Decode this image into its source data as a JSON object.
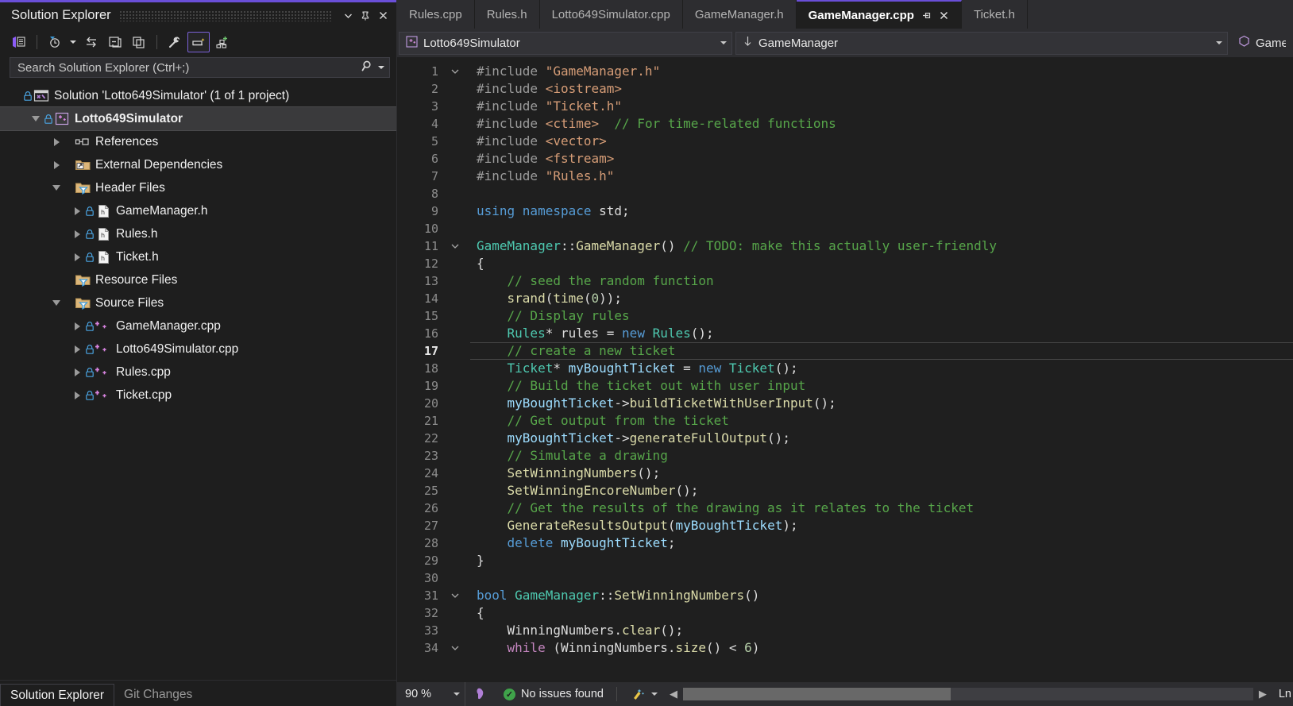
{
  "solution_explorer": {
    "title": "Solution Explorer",
    "header_buttons": [
      {
        "name": "dropdown-chevron",
        "glyph": "▾"
      },
      {
        "name": "pin",
        "glyph": "pin"
      },
      {
        "name": "close",
        "glyph": "✕"
      }
    ],
    "toolbar": [
      {
        "name": "home-view-icon",
        "label": "Home"
      },
      {
        "name": "pending-changes-icon",
        "label": "Pending Changes Filter"
      },
      {
        "name": "sync-with-active-document-icon",
        "label": "Sync with Active Document"
      },
      {
        "name": "collapse-all-icon",
        "label": "Collapse All"
      },
      {
        "name": "show-all-files-icon",
        "label": "Show All Files"
      },
      {
        "name": "properties-icon",
        "label": "Properties"
      },
      {
        "name": "preview-selected-items-icon",
        "label": "Preview Selected Items"
      },
      {
        "name": "view-class-diagram-icon",
        "label": "View Class Diagram"
      }
    ],
    "search_placeholder": "Search Solution Explorer (Ctrl+;)",
    "tree": [
      {
        "label": "Solution 'Lotto649Simulator' (1 of 1 project)",
        "indent": 0,
        "expander": "none",
        "icon": "solution",
        "lock": true,
        "selected": false,
        "bold": false
      },
      {
        "label": "Lotto649Simulator",
        "indent": 1,
        "expander": "open",
        "icon": "cpp-project",
        "lock": true,
        "selected": true,
        "bold": true
      },
      {
        "label": "References",
        "indent": 2,
        "expander": "closed",
        "icon": "references",
        "lock": false,
        "selected": false,
        "bold": false
      },
      {
        "label": "External Dependencies",
        "indent": 2,
        "expander": "closed",
        "icon": "ext-deps",
        "lock": false,
        "selected": false,
        "bold": false
      },
      {
        "label": "Header Files",
        "indent": 2,
        "expander": "open",
        "icon": "filter-folder",
        "lock": false,
        "selected": false,
        "bold": false
      },
      {
        "label": "GameManager.h",
        "indent": 3,
        "expander": "closed",
        "icon": "h-file",
        "lock": true,
        "selected": false,
        "bold": false
      },
      {
        "label": "Rules.h",
        "indent": 3,
        "expander": "closed",
        "icon": "h-file",
        "lock": true,
        "selected": false,
        "bold": false
      },
      {
        "label": "Ticket.h",
        "indent": 3,
        "expander": "closed",
        "icon": "h-file",
        "lock": true,
        "selected": false,
        "bold": false
      },
      {
        "label": "Resource Files",
        "indent": 2,
        "expander": "none",
        "icon": "filter-folder",
        "lock": false,
        "selected": false,
        "bold": false
      },
      {
        "label": "Source Files",
        "indent": 2,
        "expander": "open",
        "icon": "filter-folder",
        "lock": false,
        "selected": false,
        "bold": false
      },
      {
        "label": "GameManager.cpp",
        "indent": 3,
        "expander": "closed",
        "icon": "cpp-file",
        "lock": true,
        "selected": false,
        "bold": false
      },
      {
        "label": "Lotto649Simulator.cpp",
        "indent": 3,
        "expander": "closed",
        "icon": "cpp-file",
        "lock": true,
        "selected": false,
        "bold": false
      },
      {
        "label": "Rules.cpp",
        "indent": 3,
        "expander": "closed",
        "icon": "cpp-file",
        "lock": true,
        "selected": false,
        "bold": false
      },
      {
        "label": "Ticket.cpp",
        "indent": 3,
        "expander": "closed",
        "icon": "cpp-file",
        "lock": true,
        "selected": false,
        "bold": false
      }
    ],
    "bottom_tabs": [
      {
        "label": "Solution Explorer",
        "active": true
      },
      {
        "label": "Git Changes",
        "active": false
      }
    ]
  },
  "editor": {
    "tabs": [
      {
        "label": "Rules.cpp",
        "active": false
      },
      {
        "label": "Rules.h",
        "active": false
      },
      {
        "label": "Lotto649Simulator.cpp",
        "active": false
      },
      {
        "label": "GameManager.h",
        "active": false
      },
      {
        "label": "GameManager.cpp",
        "active": true
      },
      {
        "label": "Ticket.h",
        "active": false
      }
    ],
    "navbar": {
      "project": "Lotto649Simulator",
      "class": "GameManager",
      "member": "GameManager()"
    },
    "current_line": 17,
    "lines": [
      {
        "n": 1,
        "fold": "open",
        "indent": 0,
        "tokens": [
          {
            "t": "#include ",
            "c": "c-pre"
          },
          {
            "t": "\"GameManager.h\"",
            "c": "c-str"
          }
        ]
      },
      {
        "n": 2,
        "fold": "",
        "indent": 1,
        "tokens": [
          {
            "t": "#include ",
            "c": "c-pre"
          },
          {
            "t": "<iostream>",
            "c": "c-str"
          }
        ]
      },
      {
        "n": 3,
        "fold": "",
        "indent": 1,
        "tokens": [
          {
            "t": "#include ",
            "c": "c-pre"
          },
          {
            "t": "\"Ticket.h\"",
            "c": "c-str"
          }
        ]
      },
      {
        "n": 4,
        "fold": "",
        "indent": 1,
        "tokens": [
          {
            "t": "#include ",
            "c": "c-pre"
          },
          {
            "t": "<ctime>",
            "c": "c-str"
          },
          {
            "t": "  ",
            "c": "c-pln"
          },
          {
            "t": "// For time-related functions",
            "c": "c-cmt"
          }
        ]
      },
      {
        "n": 5,
        "fold": "",
        "indent": 1,
        "tokens": [
          {
            "t": "#include ",
            "c": "c-pre"
          },
          {
            "t": "<vector>",
            "c": "c-str"
          }
        ]
      },
      {
        "n": 6,
        "fold": "",
        "indent": 1,
        "tokens": [
          {
            "t": "#include ",
            "c": "c-pre"
          },
          {
            "t": "<fstream>",
            "c": "c-str"
          }
        ]
      },
      {
        "n": 7,
        "fold": "",
        "indent": 1,
        "tokens": [
          {
            "t": "#include ",
            "c": "c-pre"
          },
          {
            "t": "\"Rules.h\"",
            "c": "c-str"
          }
        ]
      },
      {
        "n": 8,
        "fold": "",
        "indent": 0,
        "tokens": []
      },
      {
        "n": 9,
        "fold": "",
        "indent": 0,
        "tokens": [
          {
            "t": "using namespace ",
            "c": "c-kw"
          },
          {
            "t": "std",
            "c": "c-pln"
          },
          {
            "t": ";",
            "c": "c-pln"
          }
        ]
      },
      {
        "n": 10,
        "fold": "",
        "indent": 0,
        "tokens": []
      },
      {
        "n": 11,
        "fold": "open",
        "indent": 0,
        "tokens": [
          {
            "t": "GameManager",
            "c": "c-type"
          },
          {
            "t": "::",
            "c": "c-pln"
          },
          {
            "t": "GameManager",
            "c": "c-fn"
          },
          {
            "t": "() ",
            "c": "c-pln"
          },
          {
            "t": "// TODO: make this actually user-friendly",
            "c": "c-cmt"
          }
        ]
      },
      {
        "n": 12,
        "fold": "",
        "indent": 1,
        "tokens": [
          {
            "t": "{",
            "c": "c-pln"
          }
        ]
      },
      {
        "n": 13,
        "fold": "",
        "indent": 2,
        "tokens": [
          {
            "t": "    // seed the random function",
            "c": "c-cmt"
          }
        ]
      },
      {
        "n": 14,
        "fold": "",
        "indent": 2,
        "tokens": [
          {
            "t": "    ",
            "c": "c-pln"
          },
          {
            "t": "srand",
            "c": "c-fn"
          },
          {
            "t": "(",
            "c": "c-pln"
          },
          {
            "t": "time",
            "c": "c-fn"
          },
          {
            "t": "(",
            "c": "c-pln"
          },
          {
            "t": "0",
            "c": "c-num"
          },
          {
            "t": "));",
            "c": "c-pln"
          }
        ]
      },
      {
        "n": 15,
        "fold": "",
        "indent": 2,
        "tokens": [
          {
            "t": "    // Display rules",
            "c": "c-cmt"
          }
        ]
      },
      {
        "n": 16,
        "fold": "",
        "indent": 2,
        "tokens": [
          {
            "t": "    ",
            "c": "c-pln"
          },
          {
            "t": "Rules",
            "c": "c-type"
          },
          {
            "t": "* ",
            "c": "c-pln"
          },
          {
            "t": "rules",
            "c": "c-pln"
          },
          {
            "t": " = ",
            "c": "c-pln"
          },
          {
            "t": "new ",
            "c": "c-kw"
          },
          {
            "t": "Rules",
            "c": "c-type"
          },
          {
            "t": "();",
            "c": "c-pln"
          }
        ]
      },
      {
        "n": 17,
        "fold": "",
        "indent": 2,
        "tokens": [
          {
            "t": "    // create a new ticket",
            "c": "c-cmt"
          }
        ]
      },
      {
        "n": 18,
        "fold": "",
        "indent": 2,
        "tokens": [
          {
            "t": "    ",
            "c": "c-pln"
          },
          {
            "t": "Ticket",
            "c": "c-type"
          },
          {
            "t": "* ",
            "c": "c-pln"
          },
          {
            "t": "myBoughtTicket",
            "c": "c-var"
          },
          {
            "t": " = ",
            "c": "c-pln"
          },
          {
            "t": "new ",
            "c": "c-kw"
          },
          {
            "t": "Ticket",
            "c": "c-type"
          },
          {
            "t": "();",
            "c": "c-pln"
          }
        ]
      },
      {
        "n": 19,
        "fold": "",
        "indent": 2,
        "tokens": [
          {
            "t": "    // Build the ticket out with user input",
            "c": "c-cmt"
          }
        ]
      },
      {
        "n": 20,
        "fold": "",
        "indent": 2,
        "tokens": [
          {
            "t": "    ",
            "c": "c-pln"
          },
          {
            "t": "myBoughtTicket",
            "c": "c-var"
          },
          {
            "t": "->",
            "c": "c-pln"
          },
          {
            "t": "buildTicketWithUserInput",
            "c": "c-fn"
          },
          {
            "t": "();",
            "c": "c-pln"
          }
        ]
      },
      {
        "n": 21,
        "fold": "",
        "indent": 2,
        "tokens": [
          {
            "t": "    // Get output from the ticket",
            "c": "c-cmt"
          }
        ]
      },
      {
        "n": 22,
        "fold": "",
        "indent": 2,
        "tokens": [
          {
            "t": "    ",
            "c": "c-pln"
          },
          {
            "t": "myBoughtTicket",
            "c": "c-var"
          },
          {
            "t": "->",
            "c": "c-pln"
          },
          {
            "t": "generateFullOutput",
            "c": "c-fn"
          },
          {
            "t": "();",
            "c": "c-pln"
          }
        ]
      },
      {
        "n": 23,
        "fold": "",
        "indent": 2,
        "tokens": [
          {
            "t": "    // Simulate a drawing",
            "c": "c-cmt"
          }
        ]
      },
      {
        "n": 24,
        "fold": "",
        "indent": 2,
        "tokens": [
          {
            "t": "    ",
            "c": "c-pln"
          },
          {
            "t": "SetWinningNumbers",
            "c": "c-fn"
          },
          {
            "t": "();",
            "c": "c-pln"
          }
        ]
      },
      {
        "n": 25,
        "fold": "",
        "indent": 2,
        "tokens": [
          {
            "t": "    ",
            "c": "c-pln"
          },
          {
            "t": "SetWinningEncoreNumber",
            "c": "c-fn"
          },
          {
            "t": "();",
            "c": "c-pln"
          }
        ]
      },
      {
        "n": 26,
        "fold": "",
        "indent": 2,
        "tokens": [
          {
            "t": "    // Get the results of the drawing as it relates to the ticket",
            "c": "c-cmt"
          }
        ]
      },
      {
        "n": 27,
        "fold": "",
        "indent": 2,
        "tokens": [
          {
            "t": "    ",
            "c": "c-pln"
          },
          {
            "t": "GenerateResultsOutput",
            "c": "c-fn"
          },
          {
            "t": "(",
            "c": "c-pln"
          },
          {
            "t": "myBoughtTicket",
            "c": "c-var"
          },
          {
            "t": ");",
            "c": "c-pln"
          }
        ]
      },
      {
        "n": 28,
        "fold": "",
        "indent": 2,
        "tokens": [
          {
            "t": "    ",
            "c": "c-pln"
          },
          {
            "t": "delete ",
            "c": "c-kw"
          },
          {
            "t": "myBoughtTicket",
            "c": "c-var"
          },
          {
            "t": ";",
            "c": "c-pln"
          }
        ]
      },
      {
        "n": 29,
        "fold": "",
        "indent": 1,
        "tokens": [
          {
            "t": "}",
            "c": "c-pln"
          }
        ]
      },
      {
        "n": 30,
        "fold": "",
        "indent": 0,
        "tokens": []
      },
      {
        "n": 31,
        "fold": "open",
        "indent": 0,
        "tokens": [
          {
            "t": "bool ",
            "c": "c-kw"
          },
          {
            "t": "GameManager",
            "c": "c-type"
          },
          {
            "t": "::",
            "c": "c-pln"
          },
          {
            "t": "SetWinningNumbers",
            "c": "c-fn"
          },
          {
            "t": "()",
            "c": "c-pln"
          }
        ]
      },
      {
        "n": 32,
        "fold": "",
        "indent": 1,
        "tokens": [
          {
            "t": "{",
            "c": "c-pln"
          }
        ]
      },
      {
        "n": 33,
        "fold": "",
        "indent": 2,
        "tokens": [
          {
            "t": "    ",
            "c": "c-pln"
          },
          {
            "t": "WinningNumbers",
            "c": "c-pln"
          },
          {
            "t": ".",
            "c": "c-pln"
          },
          {
            "t": "clear",
            "c": "c-fn"
          },
          {
            "t": "();",
            "c": "c-pln"
          }
        ]
      },
      {
        "n": 34,
        "fold": "open",
        "indent": 2,
        "tokens": [
          {
            "t": "    ",
            "c": "c-pln"
          },
          {
            "t": "while ",
            "c": "c-ctl"
          },
          {
            "t": "(",
            "c": "c-pln"
          },
          {
            "t": "WinningNumbers",
            "c": "c-pln"
          },
          {
            "t": ".",
            "c": "c-pln"
          },
          {
            "t": "size",
            "c": "c-fn"
          },
          {
            "t": "() < ",
            "c": "c-pln"
          },
          {
            "t": "6",
            "c": "c-num"
          },
          {
            "t": ")",
            "c": "c-pln"
          }
        ]
      }
    ]
  },
  "statusbar": {
    "zoom": "90 %",
    "issues": "No issues found",
    "caret": "Ln"
  },
  "colors": {
    "accent": "#6a4fd8",
    "editor_bg": "#1f1f1f",
    "chrome_bg": "#2d2d30",
    "panel_bg": "#1e1e1e",
    "ok_green": "#3fa34a"
  }
}
